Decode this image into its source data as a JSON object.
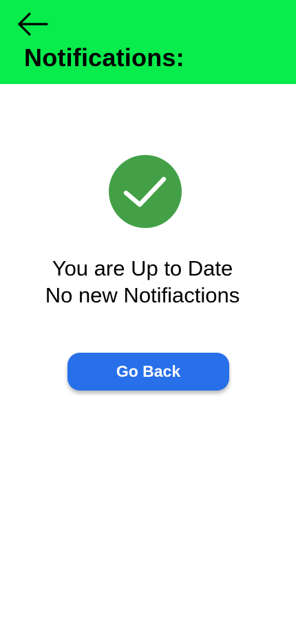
{
  "header": {
    "title": "Notifications:",
    "back_icon": "arrow-left-icon",
    "background_color": "#08EC4C"
  },
  "status": {
    "icon": "check-circle-icon",
    "icon_color": "#43A047",
    "line1": "You are Up to Date",
    "line2": "No new Notifiactions"
  },
  "actions": {
    "go_back_label": "Go Back",
    "button_color": "#2870EA"
  }
}
